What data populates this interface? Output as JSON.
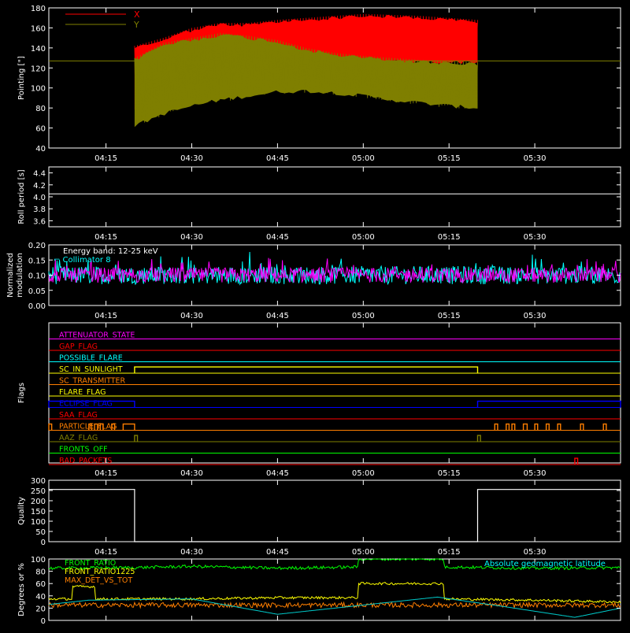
{
  "colors": {
    "background": "#000000",
    "axes": "#ffffff",
    "red": "#ff0000",
    "olive": "#7f7f00",
    "magenta": "#ff00ff",
    "cyan": "#00ffff",
    "green": "#00ff00",
    "yellow": "#ffff00",
    "orange": "#ff7f00",
    "blue": "#0000ff"
  },
  "time_ticks": [
    "04:15",
    "04:30",
    "04:45",
    "05:00",
    "05:15",
    "05:30"
  ],
  "chart_data": [
    {
      "id": "pointing",
      "type": "line",
      "ylabel": "Pointing [\"]",
      "xlim": [
        "04:05",
        "05:45"
      ],
      "ylim": [
        40,
        180
      ],
      "yticks": [
        40,
        60,
        80,
        100,
        120,
        140,
        160,
        180
      ],
      "data_start": "04:20",
      "data_end": "05:20",
      "reference_line": 127,
      "series": [
        {
          "name": "X",
          "color": "#ff0000",
          "x": [
            "04:20",
            "04:25",
            "04:30",
            "04:35",
            "04:40",
            "04:45",
            "04:50",
            "04:55",
            "05:00",
            "05:05",
            "05:10",
            "05:15",
            "05:20"
          ],
          "y_high": [
            142,
            150,
            160,
            165,
            165,
            168,
            170,
            172,
            174,
            173,
            172,
            170,
            168
          ],
          "y_low": [
            75,
            100,
            115,
            122,
            128,
            132,
            130,
            128,
            125,
            124,
            124,
            124,
            124
          ]
        },
        {
          "name": "Y",
          "color": "#7f7f00",
          "x": [
            "04:20",
            "04:25",
            "04:30",
            "04:35",
            "04:40",
            "04:45",
            "04:50",
            "04:55",
            "05:00",
            "05:05",
            "05:10",
            "05:15",
            "05:20"
          ],
          "y_high": [
            130,
            145,
            150,
            155,
            152,
            148,
            140,
            135,
            132,
            130,
            128,
            127,
            126
          ],
          "y_low": [
            60,
            72,
            80,
            86,
            90,
            94,
            95,
            93,
            90,
            86,
            83,
            80,
            78
          ]
        }
      ]
    },
    {
      "id": "roll-period",
      "type": "line",
      "ylabel": "Roll period [s]",
      "xlim": [
        "04:05",
        "05:45"
      ],
      "ylim": [
        3.5,
        4.5
      ],
      "yticks": [
        "3.6",
        "3.8",
        "4.0",
        "4.2",
        "4.4"
      ],
      "series": [
        {
          "x": [
            "04:05",
            "05:45"
          ],
          "y": [
            4.05,
            4.05
          ],
          "color": "#ffffff"
        }
      ]
    },
    {
      "id": "modulation",
      "type": "line",
      "ylabel": "Normalized modulation",
      "xlim": [
        "04:05",
        "05:45"
      ],
      "ylim": [
        0.0,
        0.2
      ],
      "yticks": [
        "0.00",
        "0.05",
        "0.10",
        "0.15",
        "0.20"
      ],
      "annotations": [
        "Energy band: 12-25 keV",
        "Collimator 8"
      ],
      "series": [
        {
          "color": "#00ffff",
          "mean": 0.1,
          "spread": 0.03
        },
        {
          "color": "#ff00ff",
          "mean": 0.1,
          "spread": 0.025
        }
      ]
    },
    {
      "id": "flags",
      "type": "line",
      "ylabel": "Flags",
      "xlim": [
        "04:05",
        "05:45"
      ],
      "flags": [
        {
          "label": "ATTENUATOR_STATE",
          "color": "#ff00ff",
          "segments": []
        },
        {
          "label": "GAP_FLAG",
          "color": "#ff0000",
          "segments": []
        },
        {
          "label": "POSSIBLE_FLARE",
          "color": "#00ffff",
          "segments": []
        },
        {
          "label": "SC_IN_SUNLIGHT",
          "color": "#ffff00",
          "segments": [
            [
              "04:20",
              "05:20"
            ]
          ]
        },
        {
          "label": "SC_TRANSMITTER",
          "color": "#ff7f00",
          "segments": []
        },
        {
          "label": "FLARE_FLAG",
          "color": "#ffff00",
          "segments": []
        },
        {
          "label": "ECLIPSE_FLAG",
          "color": "#0000ff",
          "segments": [
            [
              "04:05",
              "04:20"
            ],
            [
              "05:20",
              "05:45"
            ]
          ]
        },
        {
          "label": "SAA_FLAG",
          "color": "#ff0000",
          "segments": []
        },
        {
          "label": "PARTICLE_FLAG",
          "color": "#ff7f00",
          "segments": [
            [
              "04:05",
              "04:05:30"
            ],
            [
              "04:12",
              "04:12:30"
            ],
            [
              "04:13",
              "04:13:30"
            ],
            [
              "04:14",
              "04:14:30"
            ],
            [
              "04:16",
              "04:16:30"
            ],
            [
              "04:18",
              "04:20"
            ],
            [
              "05:23",
              "05:23:30"
            ],
            [
              "05:25",
              "05:25:30"
            ],
            [
              "05:26",
              "05:26:30"
            ],
            [
              "05:28",
              "05:28:40"
            ],
            [
              "05:30",
              "05:30:30"
            ],
            [
              "05:32",
              "05:32:30"
            ],
            [
              "05:34",
              "05:34:30"
            ],
            [
              "05:38",
              "05:38:30"
            ],
            [
              "05:42",
              "05:42:30"
            ]
          ]
        },
        {
          "label": "AAZ_FLAG",
          "color": "#7f7f00",
          "segments": [
            [
              "04:20",
              "04:20:30"
            ],
            [
              "05:20",
              "05:20:30"
            ]
          ]
        },
        {
          "label": "FRONTS_OFF",
          "color": "#00ff00",
          "segments": []
        },
        {
          "label": "BAD_PACKETS",
          "color": "#ff0000",
          "segments": [
            [
              "05:37",
              "05:37:30"
            ]
          ]
        }
      ]
    },
    {
      "id": "quality",
      "type": "line",
      "ylabel": "Quality",
      "xlim": [
        "04:05",
        "05:45"
      ],
      "ylim": [
        0,
        300
      ],
      "yticks": [
        "0",
        "50",
        "100",
        "150",
        "200",
        "250",
        "300"
      ],
      "series": [
        {
          "x": [
            "04:05",
            "04:20",
            "04:20",
            "05:20",
            "05:20",
            "05:45"
          ],
          "y": [
            255,
            255,
            0,
            0,
            255,
            255
          ],
          "color": "#ffffff"
        }
      ]
    },
    {
      "id": "ratios",
      "type": "line",
      "ylabel": "Degrees or %",
      "xlim": [
        "04:05",
        "05:45"
      ],
      "ylim": [
        0,
        100
      ],
      "yticks": [
        "0",
        "20",
        "40",
        "60",
        "80",
        "100"
      ],
      "legend": [
        {
          "label": "FRONT_RATIO",
          "color": "#00ff00"
        },
        {
          "label": "FRONT_RATIO1225",
          "color": "#ffff00"
        },
        {
          "label": "MAX_DET_VS_TOT",
          "color": "#ff7f00"
        }
      ],
      "right_label": "Absolute geomagnetic latitude",
      "series": [
        {
          "name": "FRONT_RATIO",
          "color": "#00ff00",
          "x": [
            "04:05",
            "04:20",
            "04:30",
            "04:45",
            "04:59",
            "04:59",
            "05:14",
            "05:14",
            "05:30",
            "05:45"
          ],
          "y": [
            85,
            86,
            88,
            85,
            87,
            100,
            100,
            87,
            85,
            86
          ]
        },
        {
          "name": "FRONT_RATIO1225",
          "color": "#ffff00",
          "x": [
            "04:05",
            "04:09",
            "04:09",
            "04:13",
            "04:13",
            "04:30",
            "04:45",
            "04:59",
            "04:59",
            "05:14",
            "05:14",
            "05:30",
            "05:45"
          ],
          "y": [
            35,
            35,
            55,
            55,
            35,
            35,
            37,
            37,
            60,
            60,
            35,
            33,
            30
          ]
        },
        {
          "name": "MAX_DET_VS_TOT",
          "color": "#ff7f00",
          "x": [
            "04:05",
            "05:45"
          ],
          "y": [
            25,
            25
          ]
        },
        {
          "name": "Absolute geomagnetic latitude",
          "color": "#00cccc",
          "x": [
            "04:05",
            "04:12",
            "04:30",
            "04:45",
            "05:00",
            "05:13",
            "05:25",
            "05:37",
            "05:45"
          ],
          "y": [
            26,
            33,
            35,
            10,
            25,
            38,
            22,
            5,
            20
          ]
        }
      ]
    }
  ]
}
